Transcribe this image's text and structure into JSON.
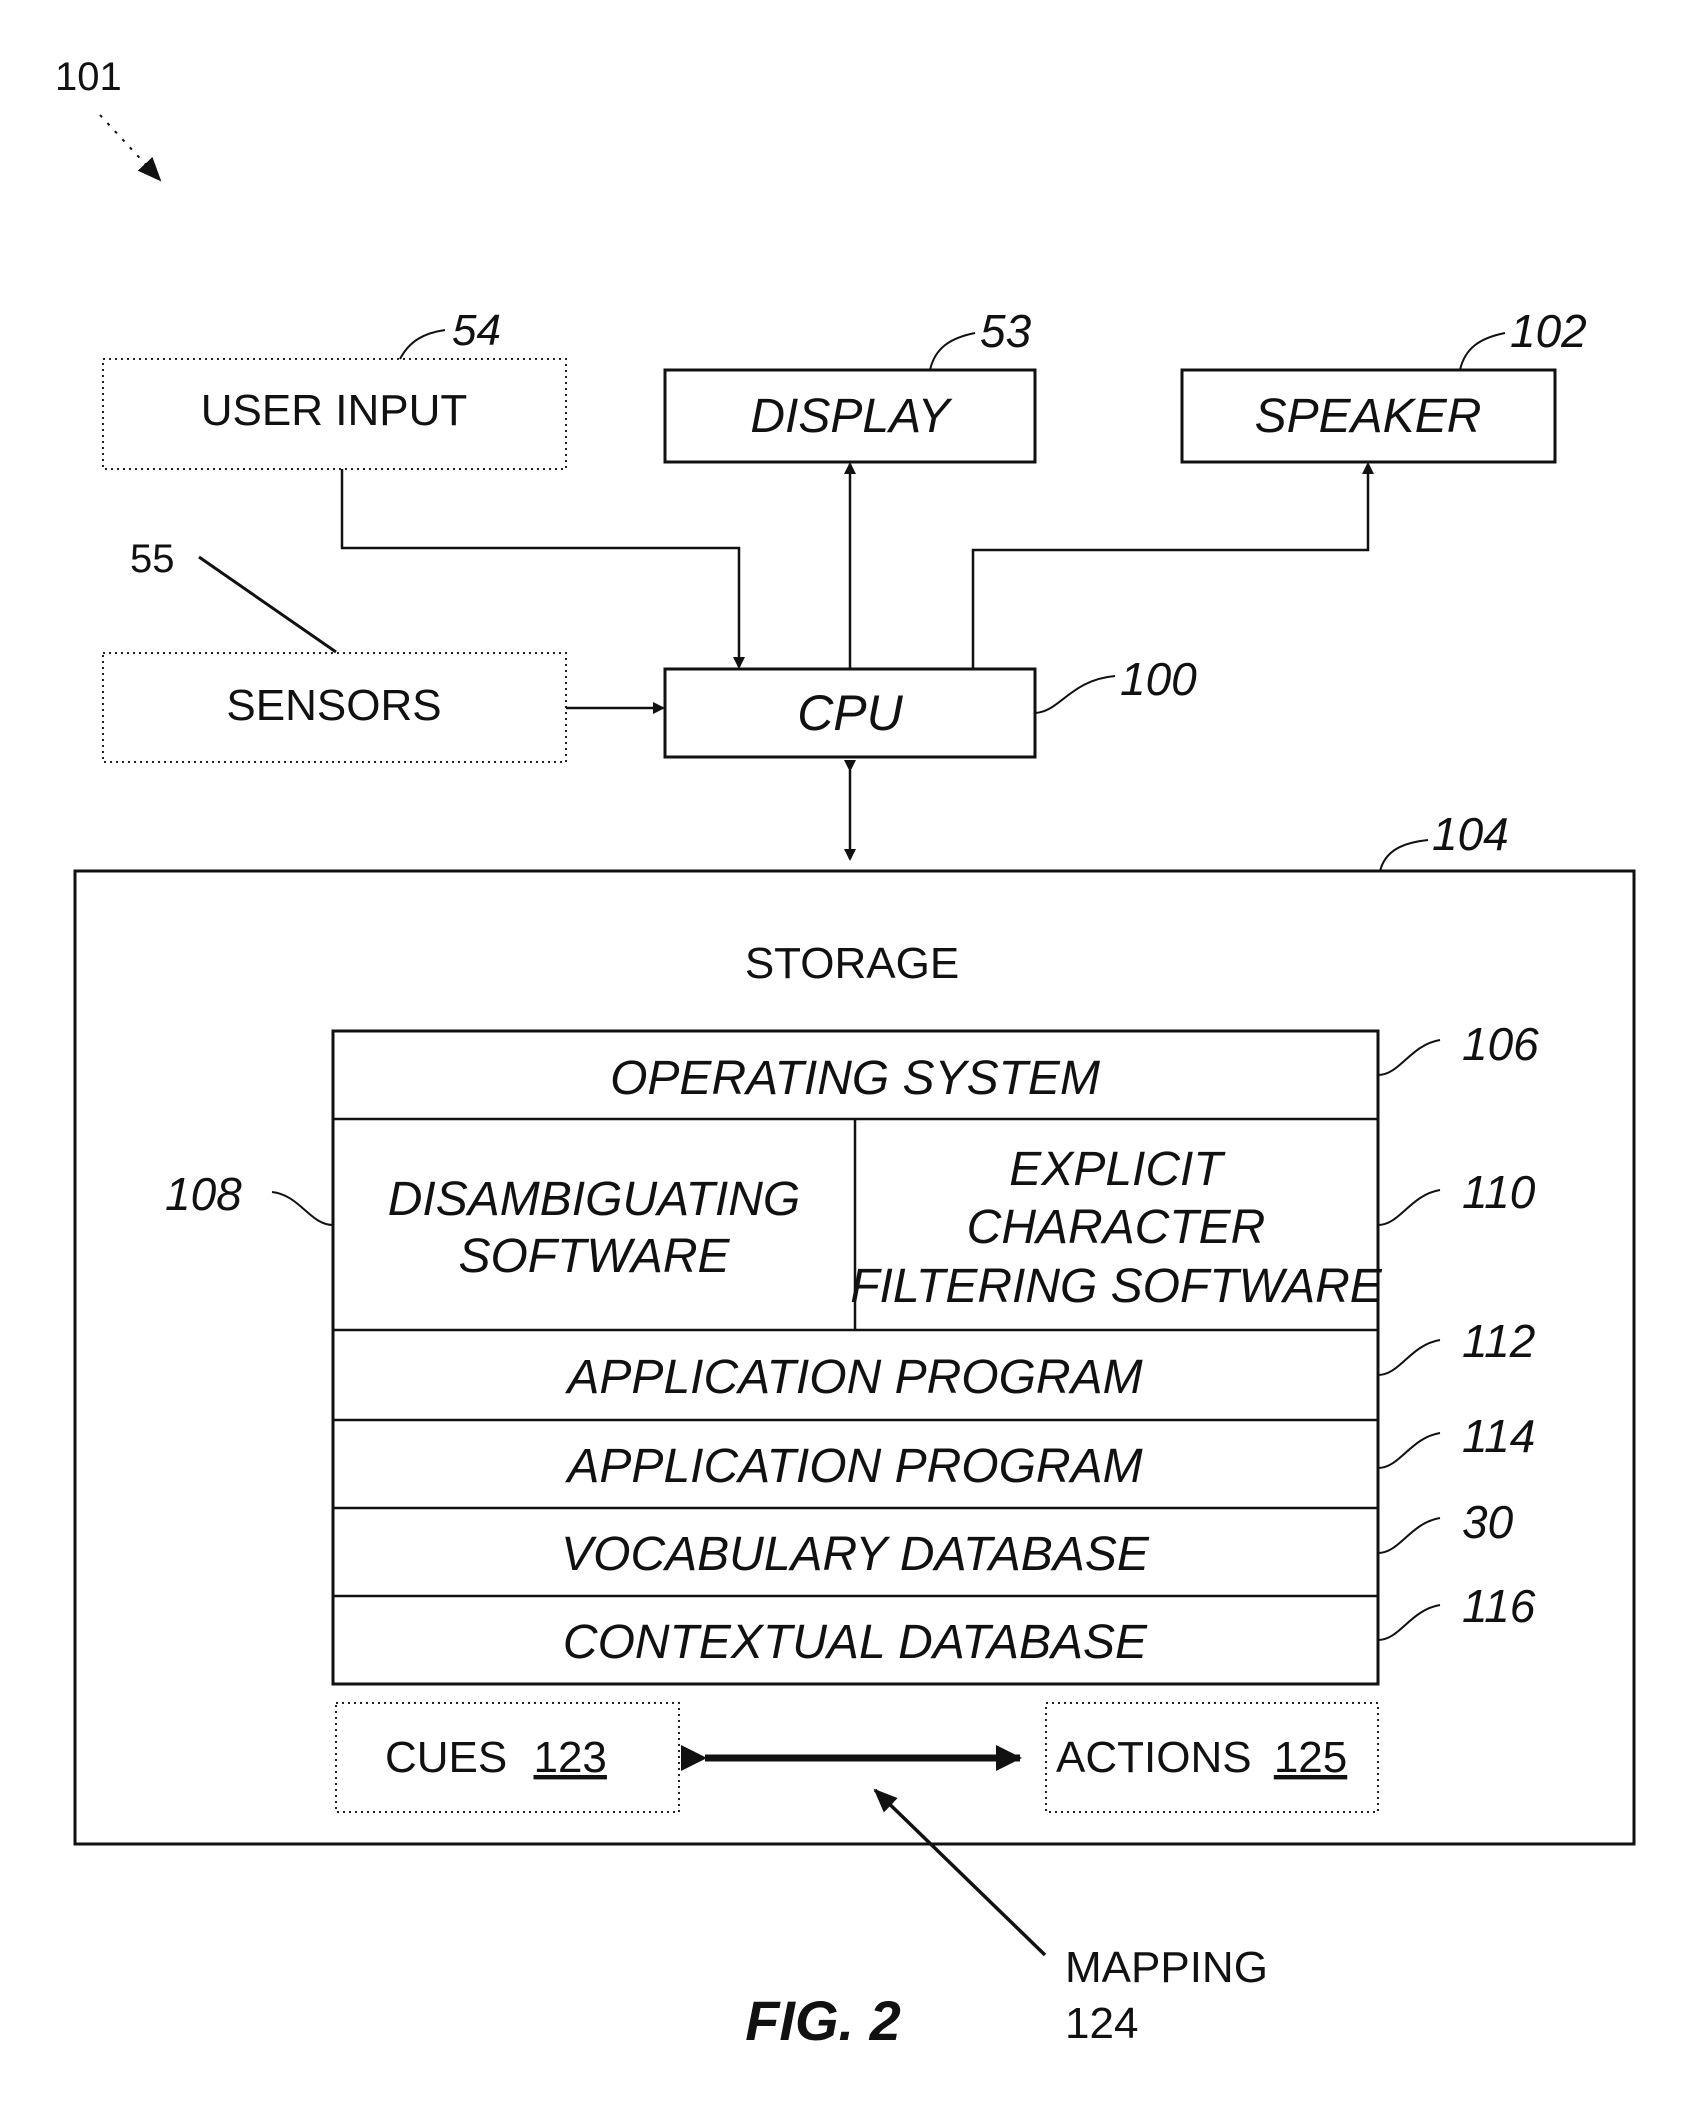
{
  "figure": {
    "ref": "101",
    "caption": "FIG. 2"
  },
  "components": {
    "user_input": {
      "label": "USER INPUT",
      "ref": "54"
    },
    "sensors": {
      "label": "SENSORS",
      "ref": "55"
    },
    "display": {
      "label": "DISPLAY",
      "ref": "53"
    },
    "speaker": {
      "label": "SPEAKER",
      "ref": "102"
    },
    "cpu": {
      "label": "CPU",
      "ref": "100"
    },
    "storage": {
      "label": "STORAGE",
      "ref": "104"
    }
  },
  "storage_stack": {
    "operating_system": {
      "label": "OPERATING SYSTEM",
      "ref": "106"
    },
    "disambiguating": {
      "line1": "DISAMBIGUATING",
      "line2": "SOFTWARE",
      "ref": "108"
    },
    "explicit": {
      "line1": "EXPLICIT",
      "line2": "CHARACTER",
      "line3": "FILTERING SOFTWARE",
      "ref": "110"
    },
    "app1": {
      "label": "APPLICATION PROGRAM",
      "ref": "112"
    },
    "app2": {
      "label": "APPLICATION PROGRAM",
      "ref": "114"
    },
    "vocab": {
      "label": "VOCABULARY DATABASE",
      "ref": "30"
    },
    "contextual": {
      "label": "CONTEXTUAL DATABASE",
      "ref": "116"
    }
  },
  "mapping": {
    "cues": {
      "label": "CUES",
      "ref": "123"
    },
    "actions": {
      "label": "ACTIONS",
      "ref": "125"
    },
    "label": "MAPPING",
    "ref": "124"
  }
}
